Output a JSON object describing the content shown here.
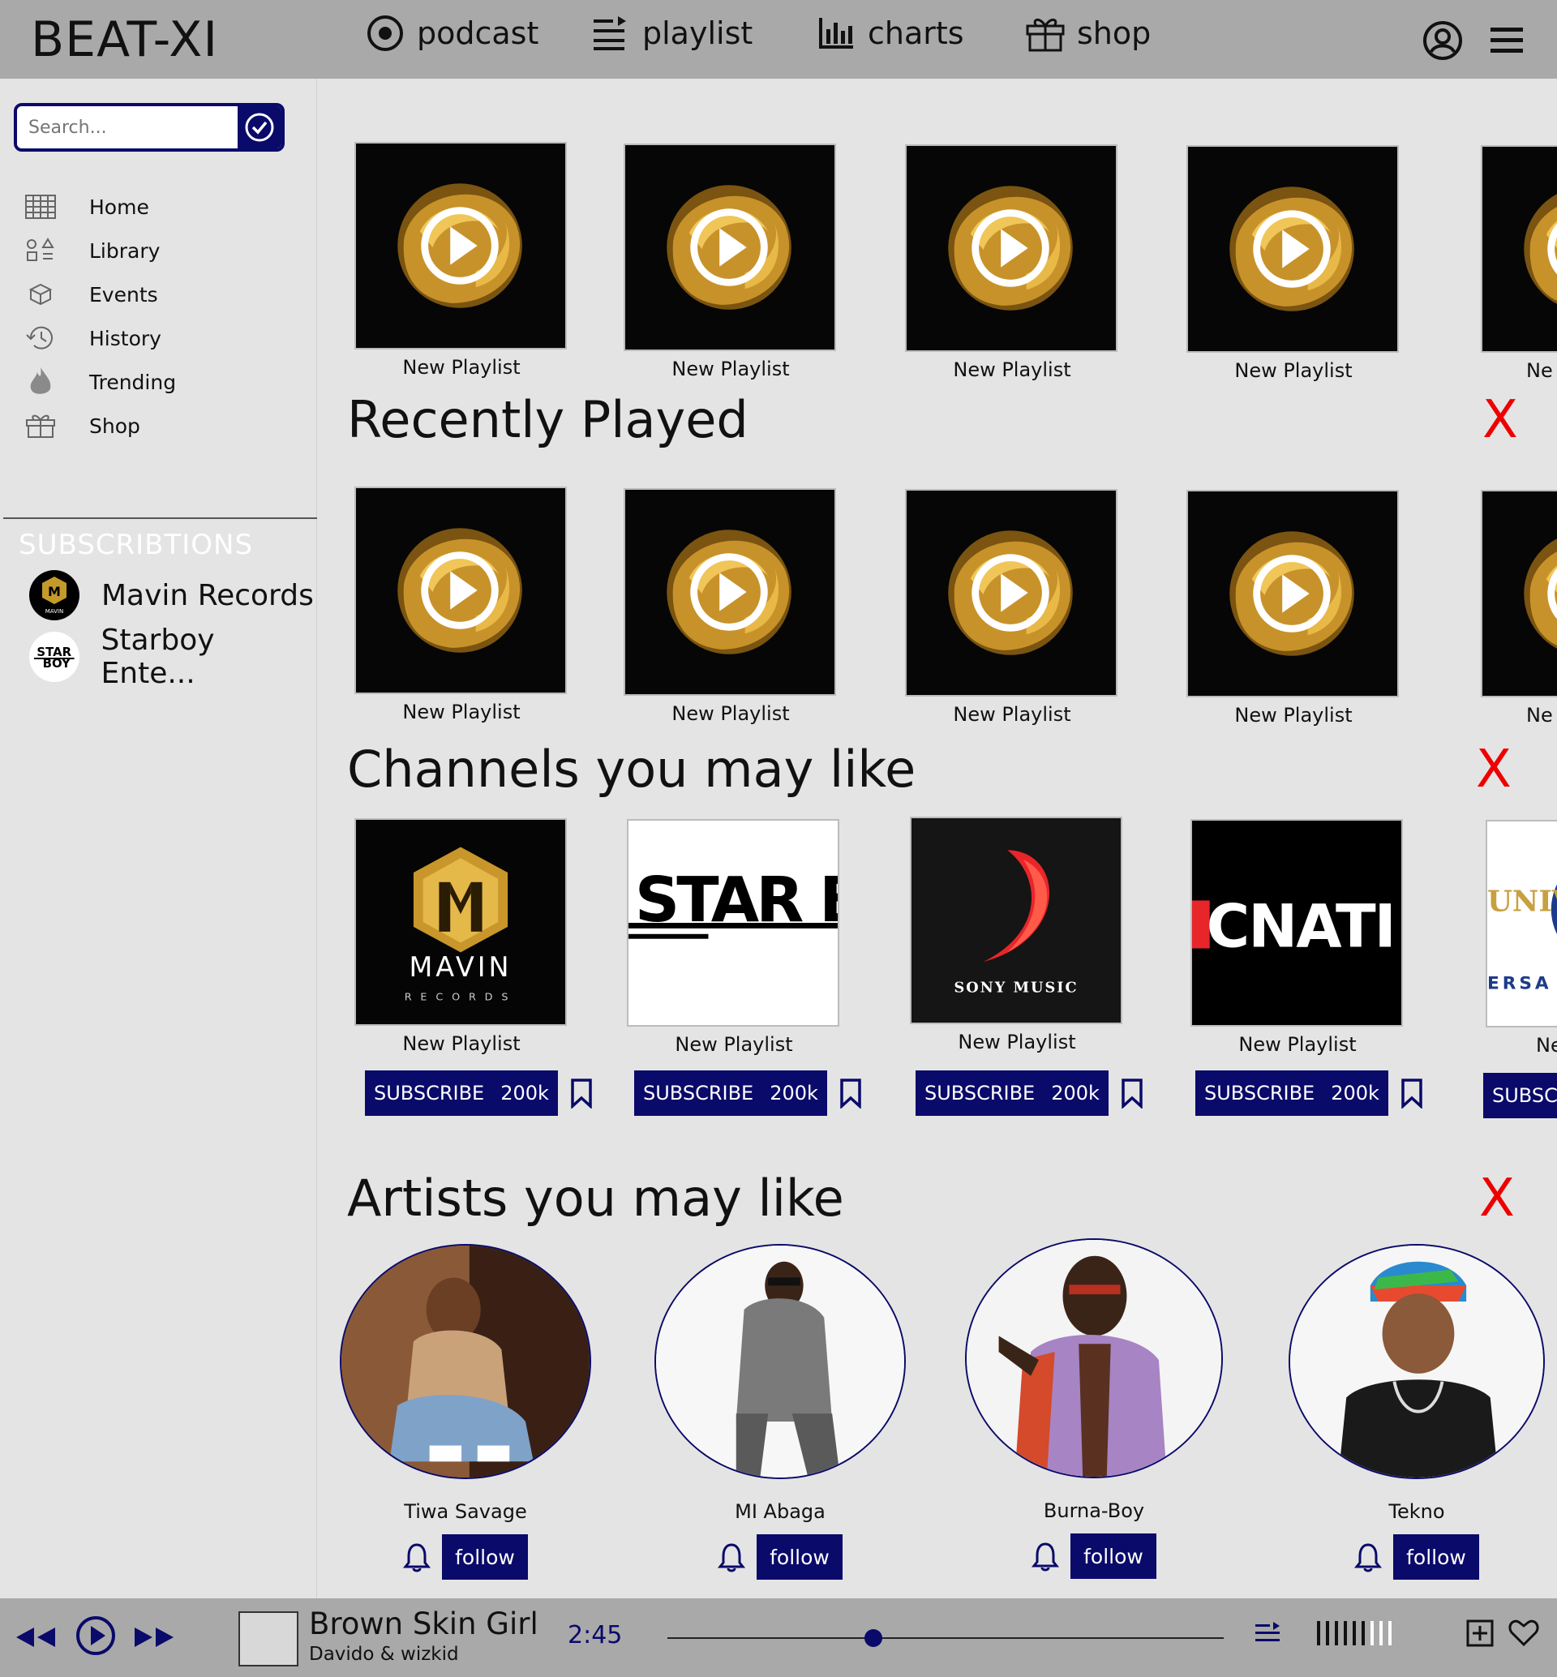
{
  "app": {
    "title": "BEAT-XI"
  },
  "topnav": [
    {
      "label": "podcast",
      "icon": "podcast-icon"
    },
    {
      "label": "playlist",
      "icon": "playlist-icon"
    },
    {
      "label": "charts",
      "icon": "charts-icon"
    },
    {
      "label": "shop",
      "icon": "gift-icon"
    }
  ],
  "search": {
    "placeholder": "Search...",
    "value": ""
  },
  "sidebar": {
    "items": [
      {
        "label": "Home",
        "icon": "grid-icon"
      },
      {
        "label": "Library",
        "icon": "library-icon"
      },
      {
        "label": "Events",
        "icon": "box-icon"
      },
      {
        "label": "History",
        "icon": "history-icon"
      },
      {
        "label": "Trending",
        "icon": "fire-icon"
      },
      {
        "label": "Shop",
        "icon": "gift-icon"
      }
    ],
    "subscriptions_title": "SUBSCRIBTIONS",
    "subscriptions": [
      {
        "label": "Mavin Records"
      },
      {
        "label": "Starboy Ente..."
      }
    ]
  },
  "main": {
    "top_row": [
      "New Playlist",
      "New Playlist",
      "New Playlist",
      "New Playlist",
      "Ne"
    ],
    "recently_played": {
      "title": "Recently Played",
      "close": "X",
      "items": [
        "New Playlist",
        "New Playlist",
        "New Playlist",
        "New Playlist",
        "Ne"
      ]
    },
    "channels": {
      "title": "Channels you may like",
      "close": "X",
      "items": [
        {
          "label": "New Playlist",
          "subscribe": "SUBSCRIBE",
          "count": "200k",
          "logo_text": "MAVIN",
          "logo_sub": "RECORDS"
        },
        {
          "label": "New Playlist",
          "subscribe": "SUBSCRIBE",
          "count": "200k",
          "logo_text": "STAR BOY",
          "logo_sub": ""
        },
        {
          "label": "New Playlist",
          "subscribe": "SUBSCRIBE",
          "count": "200k",
          "logo_text": "SONY MUSIC",
          "logo_sub": ""
        },
        {
          "label": "New Playlist",
          "subscribe": "SUBSCRIBE",
          "count": "200k",
          "logo_text": "CNATI",
          "logo_sub": ""
        },
        {
          "label": "Ne",
          "subscribe": "SUBSCR",
          "count": "",
          "logo_text": "UNIV",
          "logo_sub": "ERSA"
        }
      ]
    },
    "artists": {
      "title": "Artists you may like",
      "close": "X",
      "items": [
        {
          "name": "Tiwa Savage",
          "follow": "follow"
        },
        {
          "name": "MI Abaga",
          "follow": "follow"
        },
        {
          "name": "Burna-Boy",
          "follow": "follow"
        },
        {
          "name": "Tekno",
          "follow": "follow"
        }
      ]
    }
  },
  "player": {
    "song_title": "Brown Skin Girl",
    "song_artist": "Davido & wizkid",
    "time": "2:45",
    "progress": 0.37,
    "volume_bars": 9,
    "volume_active": 6
  },
  "colors": {
    "accent": "#0a0a6a",
    "bar": "#a9a9a9",
    "bg": "#e4e4e4",
    "close": "#ee0000"
  }
}
